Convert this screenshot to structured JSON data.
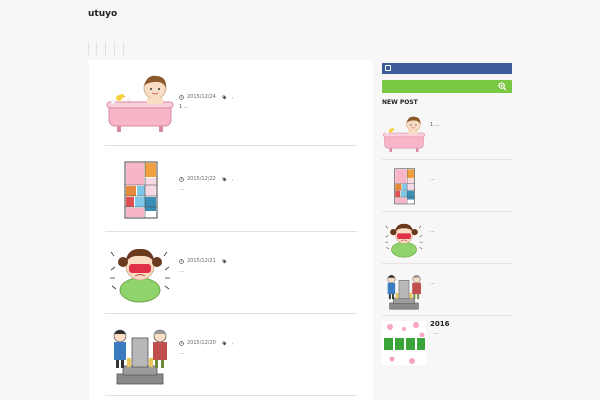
{
  "header": {
    "site_title": "utuyo",
    "nav_items": [
      "",
      "",
      "",
      ""
    ]
  },
  "posts": [
    {
      "date": "2015/12/24",
      "tag_sep": ",",
      "excerpt": "1 …",
      "image": "bathtub-illustration"
    },
    {
      "date": "2015/12/22",
      "tag_sep": ",",
      "excerpt": "…",
      "image": "floorplan-illustration"
    },
    {
      "date": "2015/12/21",
      "tag_sep": "",
      "excerpt": "…",
      "image": "crying-girl-illustration"
    },
    {
      "date": "2015/12/20",
      "tag_sep": ",",
      "excerpt": "…",
      "image": "family-grave-illustration"
    }
  ],
  "sidebar": {
    "facebook_icon": "facebook-icon",
    "search_icon": "search-icon",
    "new_post_title": "NEW POST",
    "items": [
      {
        "text": "1 …",
        "image": "bathtub-illustration"
      },
      {
        "text": "…",
        "image": "floorplan-illustration"
      },
      {
        "text": "…",
        "image": "crying-girl-illustration"
      },
      {
        "text": "…",
        "image": "family-grave-illustration"
      },
      {
        "year": "2016",
        "text": "…",
        "image": "setsubun-banner"
      }
    ]
  },
  "colors": {
    "facebook_bar": "#3b5b99",
    "search_bar": "#79c843",
    "background": "#f7f7f7"
  }
}
